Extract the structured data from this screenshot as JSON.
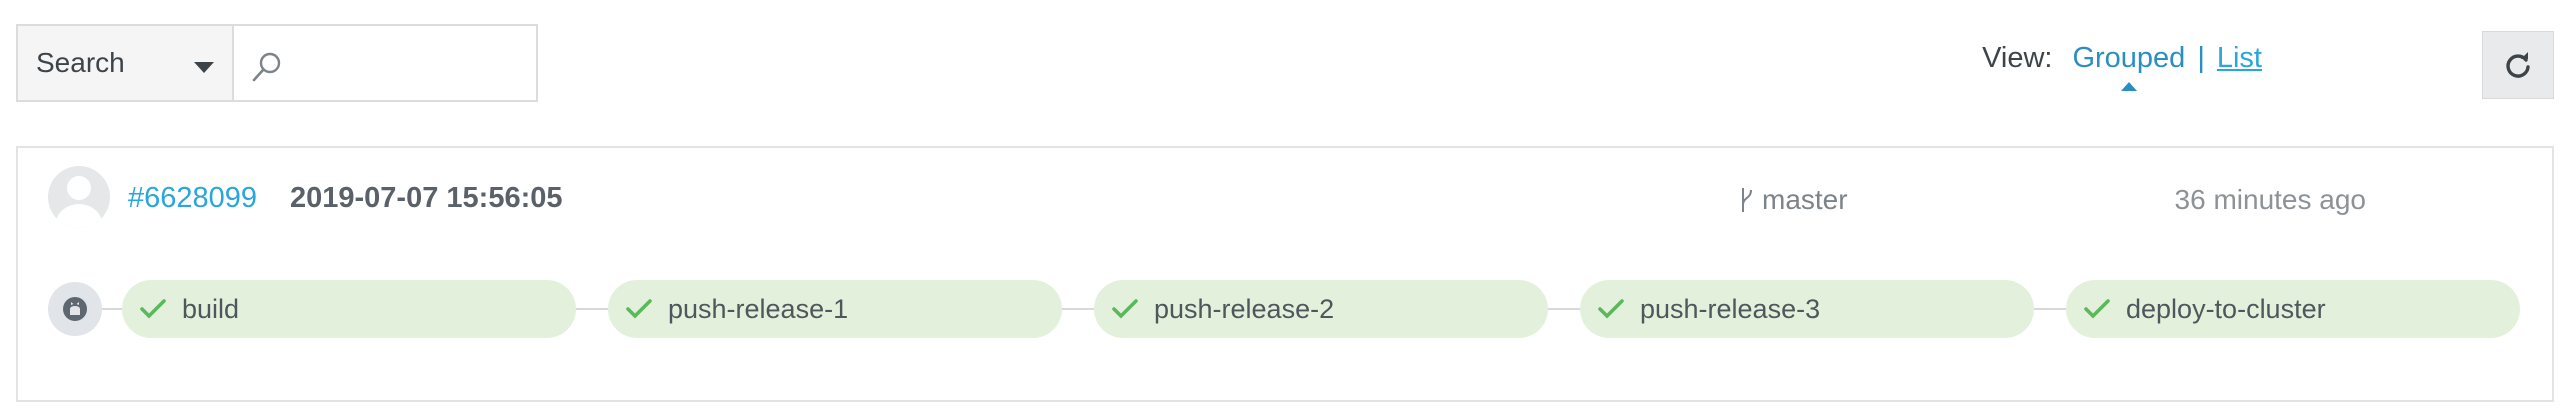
{
  "toolbar": {
    "search_select_label": "Search",
    "search_placeholder": "",
    "view_label": "View:",
    "view_grouped": "Grouped",
    "view_separator": "|",
    "view_list": "List"
  },
  "build": {
    "id": "#6628099",
    "date": "2019-07-07 15:56:05",
    "branch": "master",
    "time_ago": "36 minutes ago"
  },
  "stages": [
    {
      "name": "build",
      "status": "passed"
    },
    {
      "name": "push-release-1",
      "status": "passed"
    },
    {
      "name": "push-release-2",
      "status": "passed"
    },
    {
      "name": "push-release-3",
      "status": "passed"
    },
    {
      "name": "deploy-to-cluster",
      "status": "passed"
    }
  ],
  "colors": {
    "link": "#29a6dc",
    "stage_passed_bg": "#e3f1dc",
    "check": "#5cb85c"
  }
}
